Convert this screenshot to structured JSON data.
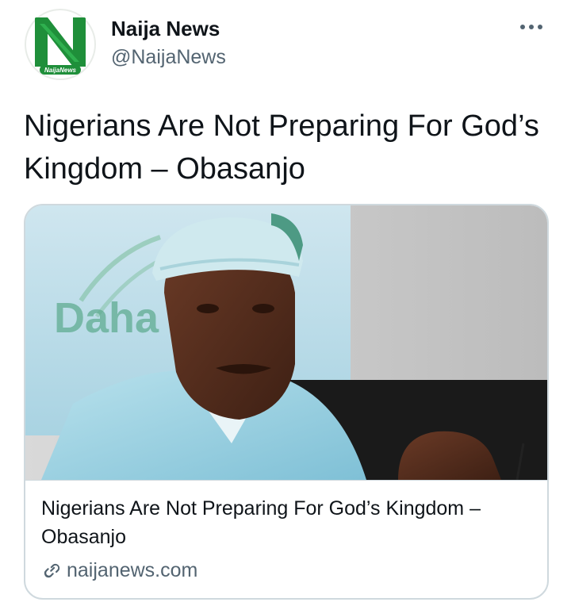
{
  "tweet": {
    "author": {
      "display_name": "Naija News",
      "handle": "@NaijaNews",
      "avatar_label": "NaijaNews",
      "avatar_icon": "naija-news-logo-icon"
    },
    "more_icon": "more-options-icon",
    "text": "Nigerians Are Not Preparing For God’s Kingdom – Obasanjo"
  },
  "card": {
    "image_caption_text": "Daha",
    "image_description_icon": "article-photo",
    "title": "Nigerians Are Not Preparing For God’s Kingdom – Obasanjo",
    "domain": "naijanews.com",
    "link_icon": "link-icon"
  },
  "colors": {
    "text_primary": "#0f1419",
    "text_secondary": "#536471",
    "border": "#cfd9de",
    "brand_green": "#1f8f3a"
  }
}
